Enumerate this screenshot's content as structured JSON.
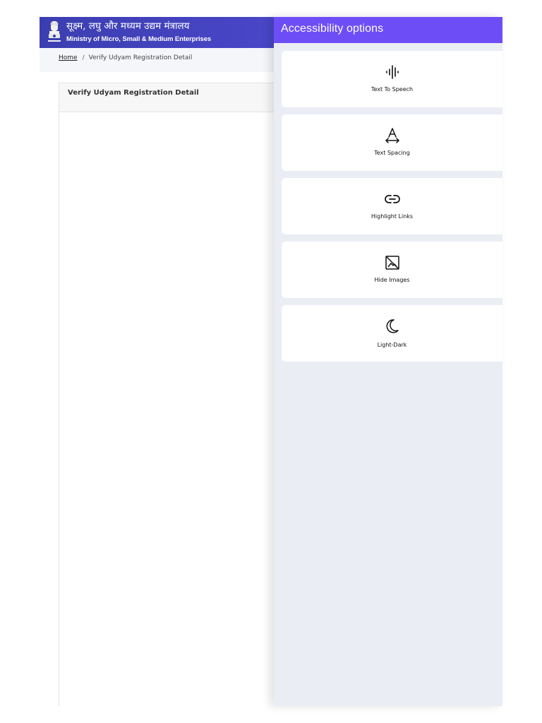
{
  "header": {
    "title_hindi": "सूक्ष्म, लघु और मध्यम उद्यम मंत्रालय",
    "title_english": "Ministry of Micro, Small & Medium Enterprises",
    "emblem_icon": "national-emblem-icon"
  },
  "breadcrumb": {
    "home": "Home",
    "separator": "/",
    "current": "Verify Udyam Registration Detail"
  },
  "card": {
    "title": "Verify Udyam Registration Detail"
  },
  "panel": {
    "title": "Accessibility options",
    "options": [
      {
        "label": "Text To Speech",
        "icon": "sound-wave-icon"
      },
      {
        "label": "Text Spacing",
        "icon": "text-spacing-icon"
      },
      {
        "label": "Highlight Links",
        "icon": "link-icon"
      },
      {
        "label": "Hide Images",
        "icon": "hide-image-icon"
      },
      {
        "label": "Light-Dark",
        "icon": "moon-icon"
      }
    ]
  },
  "colors": {
    "header_gradient_start": "#3b3eb0",
    "header_gradient_end": "#5a4fd6",
    "panel_header": "#6d4ef6",
    "panel_background": "#ebedf5"
  }
}
